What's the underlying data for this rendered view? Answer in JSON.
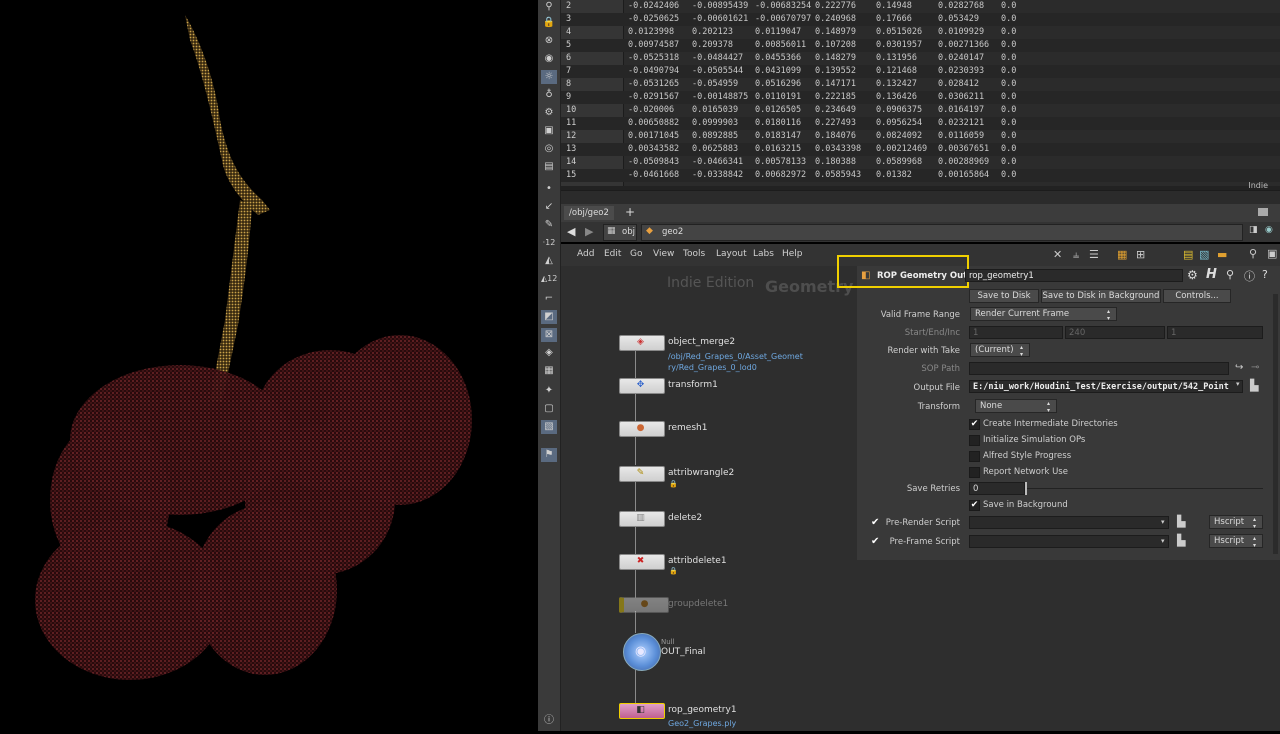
{
  "spreadsheet": {
    "rows": [
      {
        "i": "2",
        "c": [
          "-0.0242406",
          "-0.00895439",
          "-0.00683254",
          "0.222776",
          "0.14948",
          "0.0282768",
          "0.0"
        ]
      },
      {
        "i": "3",
        "c": [
          "-0.0250625",
          "-0.00601621",
          "-0.00670797",
          "0.240968",
          "0.17666",
          "0.053429",
          "0.0"
        ]
      },
      {
        "i": "4",
        "c": [
          "0.0123998",
          "0.202123",
          "0.0119047",
          "0.148979",
          "0.0515026",
          "0.0109929",
          "0.0"
        ]
      },
      {
        "i": "5",
        "c": [
          "0.00974587",
          "0.209378",
          "0.00856011",
          "0.107208",
          "0.0301957",
          "0.00271366",
          "0.0"
        ]
      },
      {
        "i": "6",
        "c": [
          "-0.0525318",
          "-0.0484427",
          "0.0455366",
          "0.148279",
          "0.131956",
          "0.0240147",
          "0.0"
        ]
      },
      {
        "i": "7",
        "c": [
          "-0.0490794",
          "-0.0505544",
          "0.0431099",
          "0.139552",
          "0.121468",
          "0.0230393",
          "0.0"
        ]
      },
      {
        "i": "8",
        "c": [
          "-0.0531265",
          "-0.054959",
          "0.0516296",
          "0.147171",
          "0.132427",
          "0.028412",
          "0.0"
        ]
      },
      {
        "i": "9",
        "c": [
          "-0.0291567",
          "-0.00148875",
          "0.0110191",
          "0.222185",
          "0.136426",
          "0.0306211",
          "0.0"
        ]
      },
      {
        "i": "10",
        "c": [
          "-0.020006",
          "0.0165039",
          "0.0126505",
          "0.234649",
          "0.0906375",
          "0.0164197",
          "0.0"
        ]
      },
      {
        "i": "11",
        "c": [
          "0.00650882",
          "0.0999903",
          "0.0180116",
          "0.227493",
          "0.0956254",
          "0.0232121",
          "0.0"
        ]
      },
      {
        "i": "12",
        "c": [
          "0.00171045",
          "0.0892885",
          "0.0183147",
          "0.184076",
          "0.0824092",
          "0.0116059",
          "0.0"
        ]
      },
      {
        "i": "13",
        "c": [
          "0.00343582",
          "0.0625883",
          "0.0163215",
          "0.0343398",
          "0.00212469",
          "0.00367651",
          "0.0"
        ]
      },
      {
        "i": "14",
        "c": [
          "-0.0509843",
          "-0.0466341",
          "0.00578133",
          "0.180388",
          "0.0589968",
          "0.00288969",
          "0.0"
        ]
      },
      {
        "i": "15",
        "c": [
          "-0.0461668",
          "-0.0338842",
          "0.00682972",
          "0.0585943",
          "0.01382",
          "0.00165864",
          "0.0"
        ]
      }
    ],
    "indie_label": "Indie"
  },
  "tabbar": {
    "tab": "/obj/geo2",
    "add": "+"
  },
  "pathbar": {
    "seg1": "obj",
    "seg2": "geo2"
  },
  "menubar": {
    "items": [
      "Add",
      "Edit",
      "Go",
      "View",
      "Tools",
      "Layout",
      "Labs",
      "Help"
    ]
  },
  "network": {
    "watermark1": "Indie Edition",
    "watermark2": "Geometry",
    "nodes": [
      {
        "name": "object_merge2",
        "sub1": "/obj/Red_Grapes_0/Asset_Geomet",
        "sub2": "ry/Red_Grapes_0_lod0"
      },
      {
        "name": "transform1"
      },
      {
        "name": "remesh1"
      },
      {
        "name": "attribwrangle2"
      },
      {
        "name": "delete2"
      },
      {
        "name": "attribdelete1"
      },
      {
        "name": "groupdelete1"
      },
      {
        "name": "OUT_Final",
        "type": "Null"
      },
      {
        "name": "rop_geometry1",
        "sub1": "Geo2_Grapes.ply"
      }
    ]
  },
  "params": {
    "node_type": "ROP Geometry Output",
    "node_name": "rop_geometry1",
    "save_to_disk": "Save to Disk",
    "save_bg": "Save to Disk in Background",
    "controls": "Controls...",
    "valid_frame_range": {
      "label": "Valid Frame Range",
      "value": "Render Current Frame"
    },
    "start_end_inc": {
      "label": "Start/End/Inc",
      "v1": "1",
      "v2": "240",
      "v3": "1"
    },
    "render_with_take": {
      "label": "Render with Take",
      "value": "(Current)"
    },
    "sop_path": {
      "label": "SOP Path",
      "value": ""
    },
    "output_file": {
      "label": "Output File",
      "value": "E:/niu_work/Houdini_Test/Exercise/output/542_Point"
    },
    "transform": {
      "label": "Transform",
      "value": "None"
    },
    "checks": [
      {
        "label": "Create Intermediate Directories",
        "checked": true
      },
      {
        "label": "Initialize Simulation OPs",
        "checked": false
      },
      {
        "label": "Alfred Style Progress",
        "checked": false
      },
      {
        "label": "Report Network Use",
        "checked": false
      }
    ],
    "save_retries": {
      "label": "Save Retries",
      "value": "0"
    },
    "save_in_bg": {
      "label": "Save in Background",
      "checked": true
    },
    "pre_render": {
      "label": "Pre-Render Script",
      "lang": "Hscript"
    },
    "pre_frame": {
      "label": "Pre-Frame Script",
      "lang": "Hscript"
    }
  },
  "colors": {
    "accent": "#f0d000",
    "node_blue": "#6fa8e0"
  }
}
